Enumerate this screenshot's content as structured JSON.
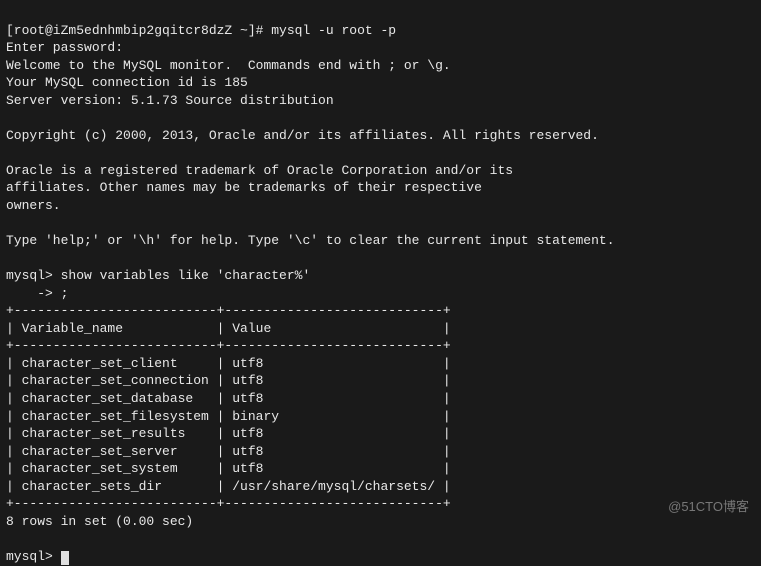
{
  "shell_prompt": "[root@iZm5ednhmbip2gqitcr8dzZ ~]# ",
  "shell_cmd": "mysql -u root -p",
  "lines": {
    "enter_pw": "Enter password:",
    "welcome": "Welcome to the MySQL monitor.  Commands end with ; or \\g.",
    "conn_id": "Your MySQL connection id is 185",
    "srv_ver": "Server version: 5.1.73 Source distribution",
    "copyright": "Copyright (c) 2000, 2013, Oracle and/or its affiliates. All rights reserved.",
    "tm1": "Oracle is a registered trademark of Oracle Corporation and/or its",
    "tm2": "affiliates. Other names may be trademarks of their respective",
    "tm3": "owners.",
    "help": "Type 'help;' or '\\h' for help. Type '\\c' to clear the current input statement."
  },
  "mysql_prompt": "mysql> ",
  "query_line1": "show variables like 'character%'",
  "cont_prompt": "    -> ",
  "query_line2": ";",
  "table": {
    "border": "+--------------------------+----------------------------+",
    "header": "| Variable_name            | Value                      |",
    "rows": [
      "| character_set_client     | utf8                       |",
      "| character_set_connection | utf8                       |",
      "| character_set_database   | utf8                       |",
      "| character_set_filesystem | binary                     |",
      "| character_set_results    | utf8                       |",
      "| character_set_server     | utf8                       |",
      "| character_set_system     | utf8                       |",
      "| character_sets_dir       | /usr/share/mysql/charsets/ |"
    ],
    "summary": "8 rows in set (0.00 sec)"
  },
  "chart_data": {
    "type": "table",
    "title": "MySQL character variables",
    "columns": [
      "Variable_name",
      "Value"
    ],
    "rows": [
      [
        "character_set_client",
        "utf8"
      ],
      [
        "character_set_connection",
        "utf8"
      ],
      [
        "character_set_database",
        "utf8"
      ],
      [
        "character_set_filesystem",
        "binary"
      ],
      [
        "character_set_results",
        "utf8"
      ],
      [
        "character_set_server",
        "utf8"
      ],
      [
        "character_set_system",
        "utf8"
      ],
      [
        "character_sets_dir",
        "/usr/share/mysql/charsets/"
      ]
    ]
  },
  "watermark": "@51CTO博客"
}
